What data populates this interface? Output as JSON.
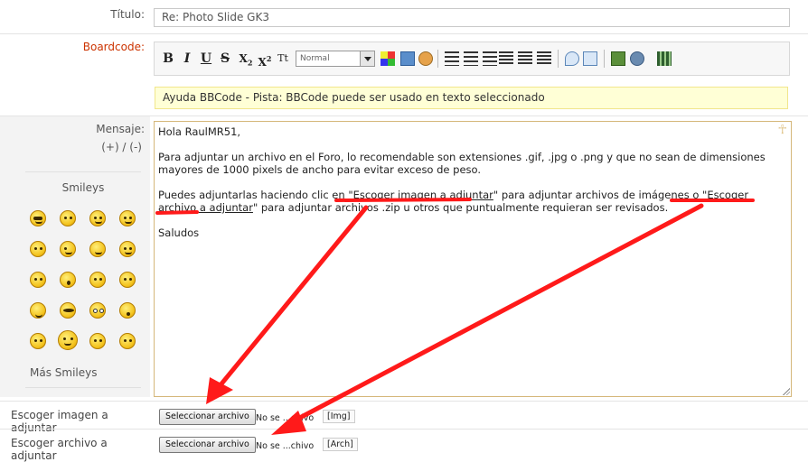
{
  "form": {
    "title_label": "Título:",
    "title_value": "Re: Photo Slide GK3",
    "boardcode_label": "Boardcode:",
    "font_select": "Normal",
    "hint": "Ayuda BBCode - Pista: BBCode puede ser usado en texto seleccionado",
    "message_label": "Mensaje:",
    "resize_label": "(+) / (-)",
    "smileys_label": "Smileys",
    "more_smileys": "Más Smileys",
    "message": {
      "p1": "Hola RaulMR51,",
      "p2": "Para adjuntar un archivo en el Foro, lo recomendable son extensiones .gif, .jpg o .png y que no sean de dimensiones mayores de 1000 pixels de ancho para evitar exceso de peso.",
      "p3a": "Puedes adjuntarlas haciendo clic en \"",
      "p3b": "Escoger imagen a adjuntar",
      "p3c": "\" para adjuntar archivos de imágenes o \"",
      "p3d": "Escoger archivo a adjuntar",
      "p3e": "\" para adjuntar archivos .zip u otros que puntualmente requieran ser revisados.",
      "p4": "Saludos"
    },
    "image_label": "Escoger imagen a adjuntar",
    "file_label": "Escoger archivo a adjuntar",
    "select_button": "Seleccionar archivo",
    "no_file_img": "No se ...chivo",
    "no_file_arch": "No se ...chivo",
    "img_tag": "[Img]",
    "arch_tag": "[Arch]"
  },
  "toolbar_buttons": [
    "B",
    "I",
    "U",
    "S",
    "X₂",
    "X²",
    "Tt"
  ],
  "colors": {
    "annotation": "#ff1a1a",
    "hint_bg": "#ffffd6",
    "label_red": "#cc3300"
  }
}
